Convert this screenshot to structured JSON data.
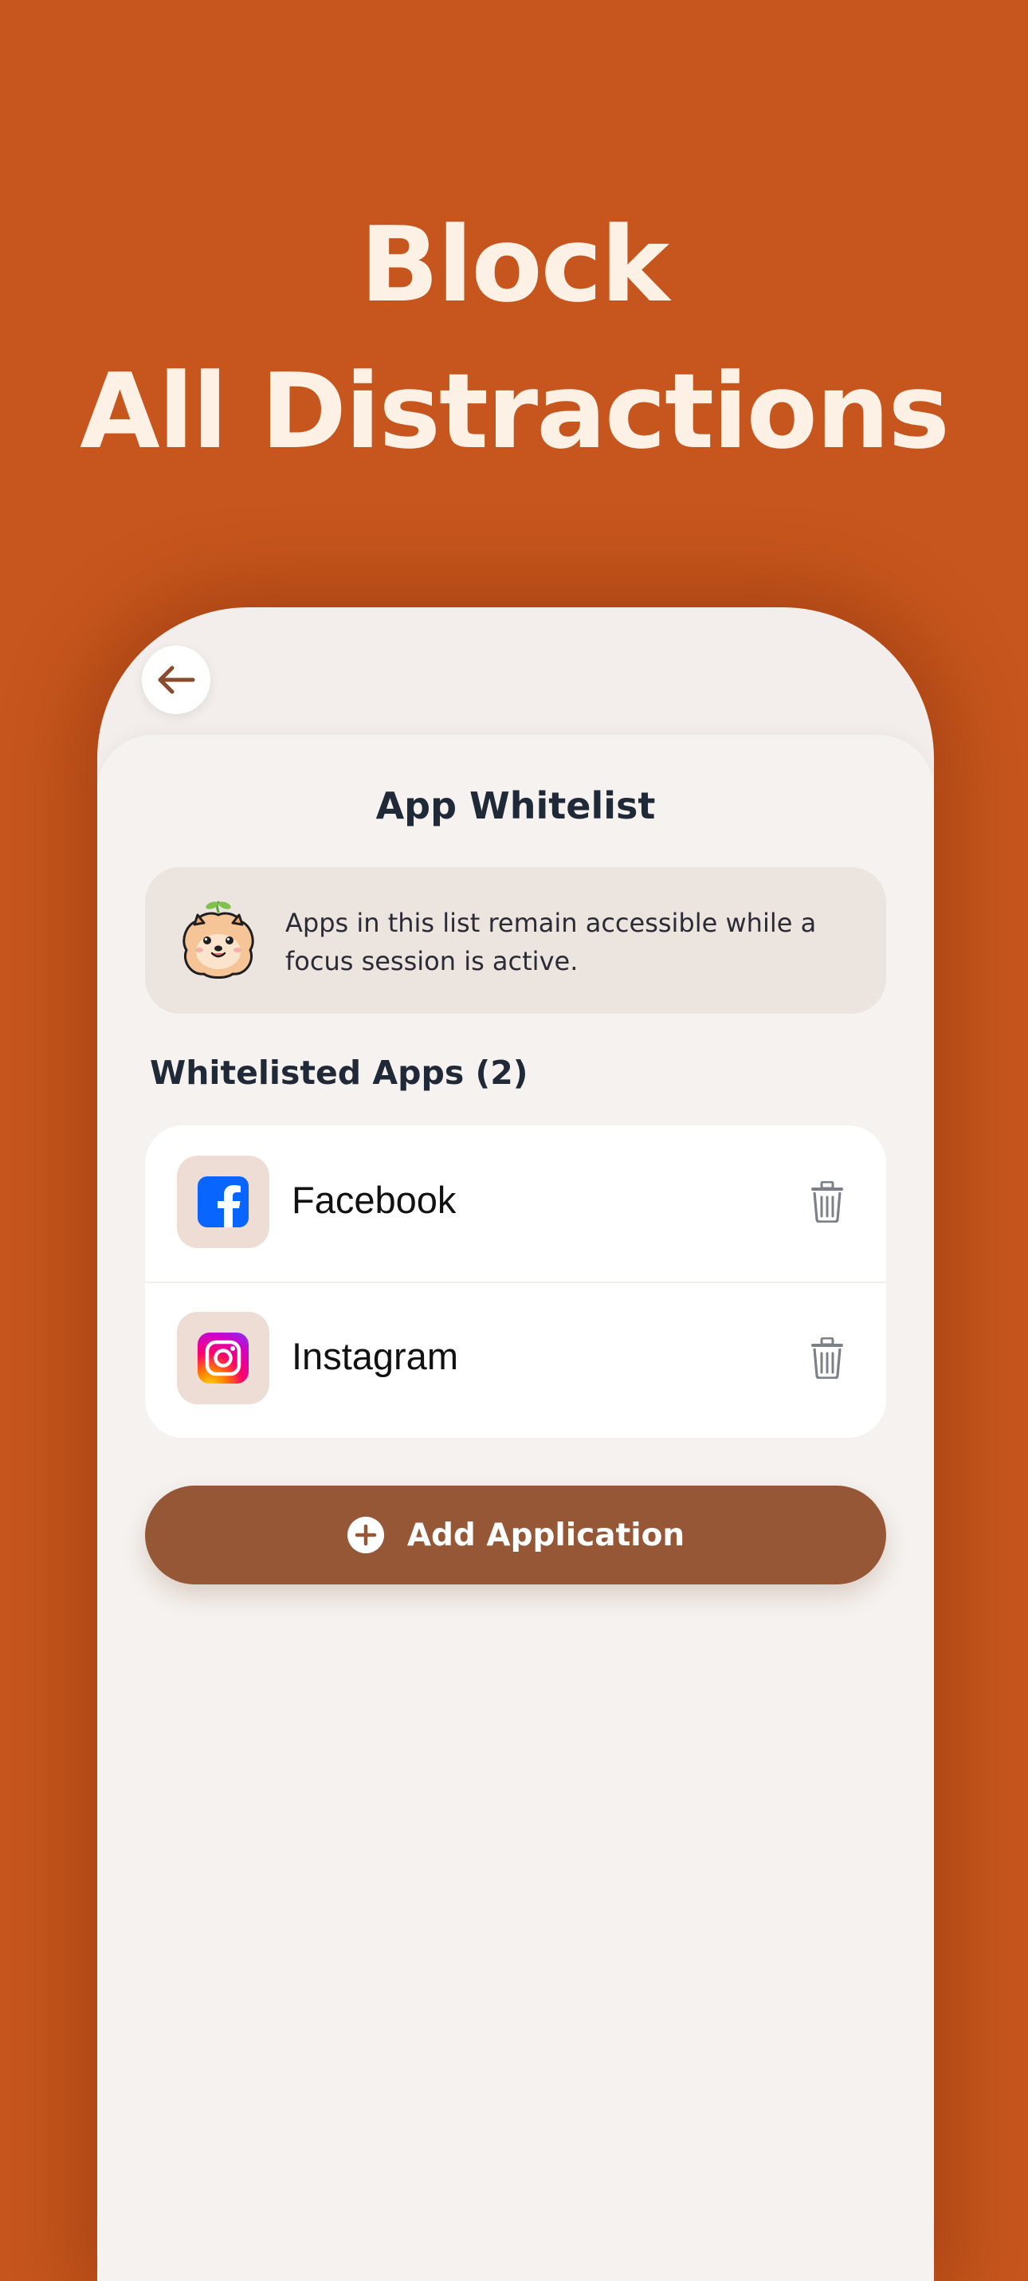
{
  "headline": {
    "line1": "Block",
    "line2": "All Distractions"
  },
  "screen": {
    "back_icon": "arrow-left-icon",
    "title": "App Whitelist",
    "info": {
      "mascot_icon": "pomeranian-mascot-icon",
      "text": "Apps in this list remain accessible while a focus session is active."
    },
    "section_title": "Whitelisted Apps (2)",
    "apps": [
      {
        "name": "Facebook",
        "icon": "facebook-icon",
        "action_icon": "trash-icon"
      },
      {
        "name": "Instagram",
        "icon": "instagram-icon",
        "action_icon": "trash-icon"
      }
    ],
    "add_button": {
      "icon": "plus-circle-icon",
      "label": "Add Application"
    }
  },
  "colors": {
    "background": "#C6561D",
    "headline": "#FDF1E6",
    "screen_bg": "#F5F2EF",
    "info_card": "#ECE4DF",
    "icon_tile": "#EEDDD5",
    "primary_button": "#955736",
    "title_text": "#1F2937",
    "facebook_blue": "#0866FF"
  }
}
